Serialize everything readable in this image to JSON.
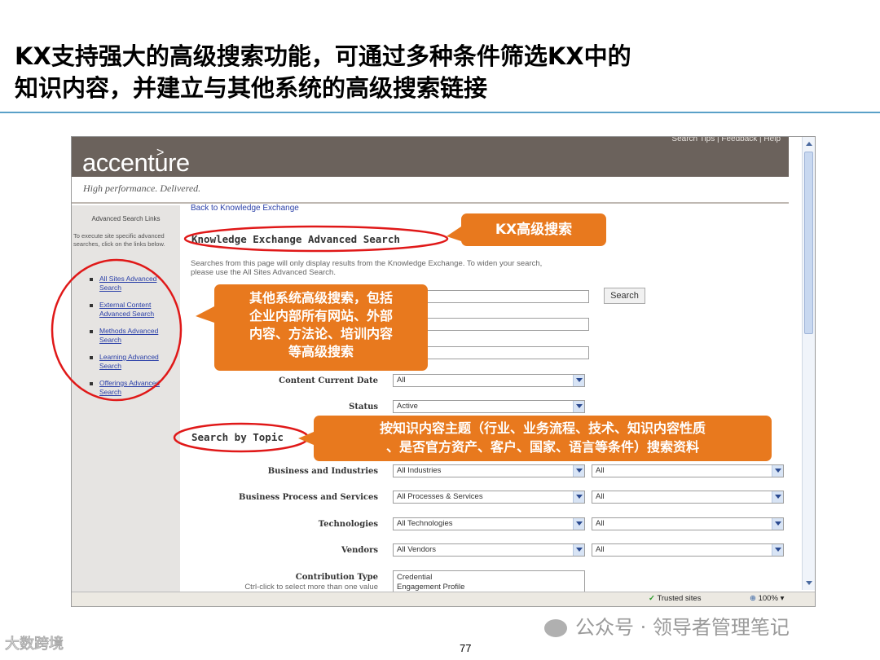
{
  "slide": {
    "title_line1": "KX支持强大的高级搜索功能，可通过多种条件筛选KX中的",
    "title_line2": "知识内容，并建立与其他系统的高级搜索链接",
    "page_number": "77",
    "watermark": "公众号 · 领导者管理笔记",
    "corner_logo": "大数跨境"
  },
  "browser": {
    "top_links": "Search Tips   |   Feedback   |   Help",
    "logo_text": "accenture",
    "logo_mark": ">",
    "tagline": "High performance. Delivered.",
    "status_trusted": "Trusted sites",
    "status_zoom": "100%"
  },
  "sidebar": {
    "heading": "Advanced Search Links",
    "description": "To execute site specific advanced searches, click on the links below.",
    "links": [
      "All Sites Advanced Search",
      "External Content Advanced Search",
      "Methods Advanced Search",
      "Learning Advanced Search",
      "Offerings Advanced Search"
    ]
  },
  "main": {
    "back_link": "Back to Knowledge Exchange",
    "heading": "Knowledge Exchange Advanced Search",
    "intro": "Searches from this page will only display results from the Knowledge Exchange. To widen your search, please use the All Sites Advanced Search.",
    "search_button": "Search",
    "content_date_label": "Content Current Date",
    "content_date_value": "All",
    "status_label": "Status",
    "status_value": "Active",
    "topic_heading": "Search by Topic",
    "topic_rows": [
      {
        "label": "Business and Industries",
        "primary": "All Industries",
        "secondary": "All"
      },
      {
        "label": "Business Process and Services",
        "primary": "All Processes & Services",
        "secondary": "All"
      },
      {
        "label": "Technologies",
        "primary": "All Technologies",
        "secondary": "All"
      },
      {
        "label": "Vendors",
        "primary": "All Vendors",
        "secondary": "All"
      }
    ],
    "contribution_label": "Contribution Type",
    "contribution_hint": "Ctrl-click to select more than one value",
    "contribution_options": [
      "Credential",
      "Engagement Profile"
    ]
  },
  "callouts": {
    "kx_search": "KX高级搜索",
    "other_systems": [
      "其他系统高级搜索，包括",
      "企业内部所有网站、外部",
      "内容、方法论、培训内容",
      "等高级搜索"
    ],
    "by_topic": [
      "按知识内容主题（行业、业务流程、技术、知识内容性质",
      "、是否官方资产、客户、国家、语言等条件）搜索资料"
    ]
  },
  "colors": {
    "callout": "#e8791e",
    "highlight_ring": "#e01818",
    "banner": "#6b625c",
    "title_rule": "#5aa0c8"
  }
}
